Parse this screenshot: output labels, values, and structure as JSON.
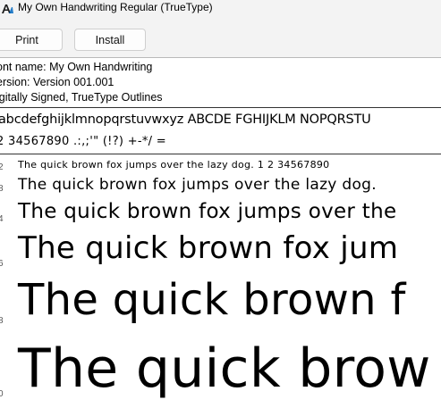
{
  "window": {
    "title": "My Own Handwriting Regular (TrueType)"
  },
  "toolbar": {
    "print_label": "Print",
    "install_label": "Install"
  },
  "font_info": {
    "name_line": "ont name: My Own Handwriting",
    "version_line": "ersion: Version 001.001",
    "signed_line": "igitally Signed, TrueType Outlines"
  },
  "charset": {
    "line1": "abcdefghijklmnopqrstuvwxyz ABCDE FGHIJKLM NOPQRSTU",
    "line2": "2 34567890 .:,;'\" (!?) +-*/ ="
  },
  "samples": [
    {
      "size_label": "2",
      "text": "The quick brown fox jumps over the lazy dog. 1 2 34567890"
    },
    {
      "size_label": "8",
      "text": "The quick brown fox jumps over the lazy dog."
    },
    {
      "size_label": "4",
      "text": "The quick brown fox jumps over the"
    },
    {
      "size_label": "6",
      "text": "The quick brown fox jum"
    },
    {
      "size_label": "8",
      "text": "The quick brown f"
    },
    {
      "size_label": "0",
      "text": "The quick brow"
    }
  ]
}
